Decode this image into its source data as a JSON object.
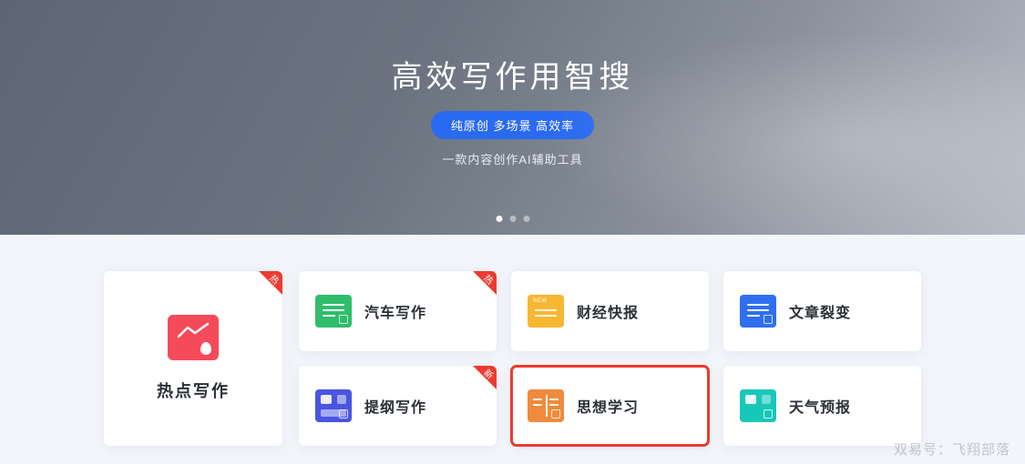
{
  "hero": {
    "title": "高效写作用智搜",
    "pill": "纯原创 多场景 高效率",
    "subtitle": "一款内容创作AI辅助工具"
  },
  "corner": {
    "hot": "热",
    "new": "新"
  },
  "feature": {
    "title": "热点写作",
    "corner": "hot"
  },
  "cards": [
    {
      "label": "汽车写作",
      "icon": "car",
      "corner": "hot"
    },
    {
      "label": "财经快报",
      "icon": "fin",
      "corner": null
    },
    {
      "label": "文章裂变",
      "icon": "split",
      "corner": null
    },
    {
      "label": "提纲写作",
      "icon": "outline",
      "corner": "new"
    },
    {
      "label": "思想学习",
      "icon": "think",
      "corner": null,
      "highlight": true
    },
    {
      "label": "天气预报",
      "icon": "weather",
      "corner": null
    }
  ],
  "watermark": "双易号：飞翔部落"
}
